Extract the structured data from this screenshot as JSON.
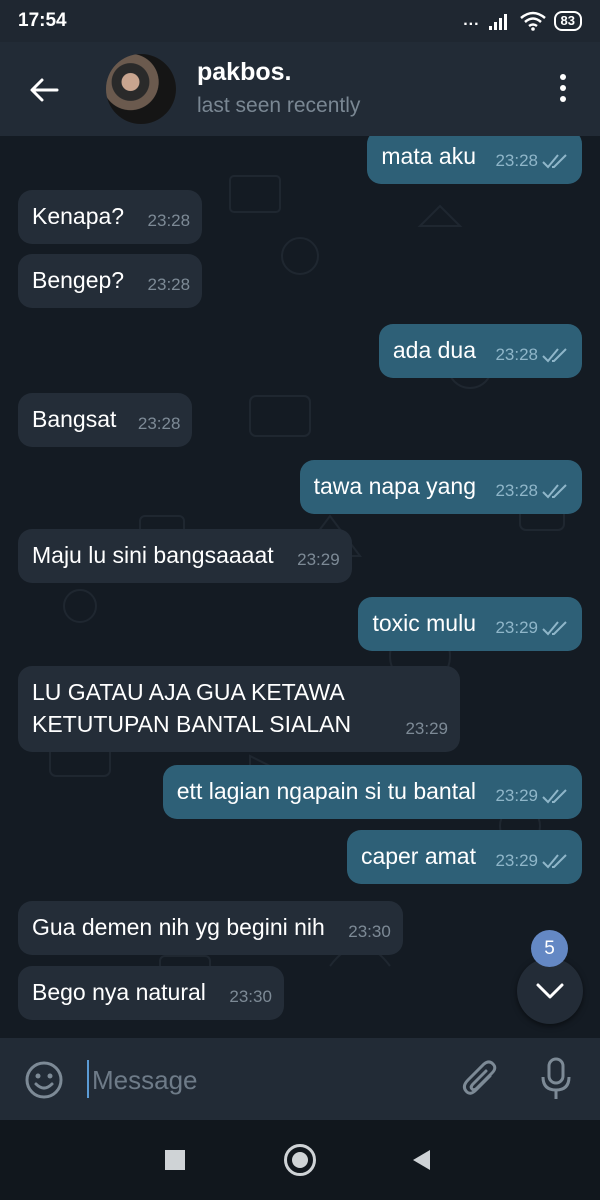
{
  "status_bar": {
    "time": "17:54",
    "signal_text": "...",
    "battery": "83"
  },
  "header": {
    "contact_name": "pakbos.",
    "contact_status": "last seen recently",
    "back_icon": "arrow-left-icon",
    "menu_icon": "more-vertical-icon"
  },
  "messages": [
    {
      "dir": "out",
      "text": "mata aku",
      "time": "23:28",
      "read": true
    },
    {
      "dir": "in",
      "text": "Kenapa?",
      "time": "23:28"
    },
    {
      "dir": "in",
      "text": "Bengep?",
      "time": "23:28"
    },
    {
      "dir": "out",
      "text": "ada dua",
      "time": "23:28",
      "read": true
    },
    {
      "dir": "in",
      "text": "Bangsat",
      "time": "23:28"
    },
    {
      "dir": "out",
      "text": "tawa napa yang",
      "time": "23:28",
      "read": true
    },
    {
      "dir": "in",
      "text": "Maju lu sini bangsaaaat",
      "time": "23:29"
    },
    {
      "dir": "out",
      "text": "toxic mulu",
      "time": "23:29",
      "read": true
    },
    {
      "dir": "in",
      "text": "LU GATAU AJA GUA KETAWA\nKETUTUPAN BANTAL SIALAN",
      "time": "23:29"
    },
    {
      "dir": "out",
      "text": "ett lagian ngapain si tu bantal",
      "time": "23:29",
      "read": true
    },
    {
      "dir": "out",
      "text": "caper amat",
      "time": "23:29",
      "read": true
    },
    {
      "dir": "in",
      "text": "Gua demen nih yg begini nih",
      "time": "23:30"
    },
    {
      "dir": "in",
      "text": "Bego nya natural",
      "time": "23:30"
    }
  ],
  "scroll_down": {
    "unread_count": "5",
    "icon": "chevron-down-icon"
  },
  "input": {
    "placeholder": "Message",
    "value": "",
    "emoji_icon": "emoji-icon",
    "attach_icon": "paperclip-icon",
    "mic_icon": "microphone-icon"
  },
  "nav": {
    "recents_icon": "square-icon",
    "home_icon": "circle-icon",
    "back_icon": "triangle-back-icon"
  },
  "colors": {
    "background": "#141b23",
    "incoming_bubble": "#242d38",
    "outgoing_bubble": "#2e6077",
    "header": "#222b36",
    "badge": "#6488c4",
    "read_ticks": "#8fb6c9"
  }
}
